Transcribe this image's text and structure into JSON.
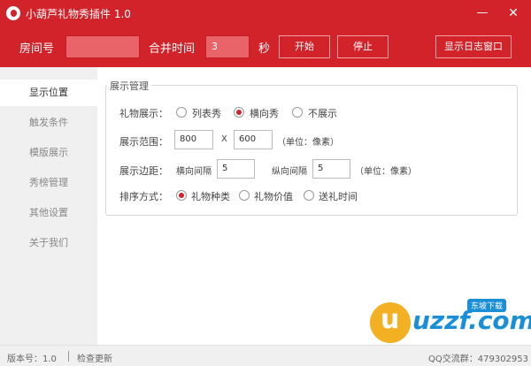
{
  "window": {
    "title": "小葫芦礼物秀插件 1.0",
    "minimize": "—",
    "close": "✕"
  },
  "toolbar": {
    "room_label": "房间号",
    "room_value": "",
    "merge_label": "合并时间",
    "merge_value": "3",
    "seconds_label": "秒",
    "start_label": "开始",
    "stop_label": "停止",
    "log_label": "显示日志窗口"
  },
  "sidebar": {
    "items": [
      {
        "label": "显示位置",
        "active": true
      },
      {
        "label": "触发条件",
        "active": false
      },
      {
        "label": "模版展示",
        "active": false
      },
      {
        "label": "秀榜管理",
        "active": false
      },
      {
        "label": "其他设置",
        "active": false
      },
      {
        "label": "关于我们",
        "active": false
      }
    ]
  },
  "display": {
    "group_title": "展示管理",
    "gift_show": {
      "label": "礼物展示：",
      "options": [
        "列表秀",
        "横向秀",
        "不展示"
      ],
      "selected": "横向秀"
    },
    "range": {
      "label": "展示范围：",
      "width": "800",
      "x": "X",
      "height": "600",
      "unit": "（单位：像素）"
    },
    "margin": {
      "label": "展示边距：",
      "h_label": "横向间隔",
      "h_value": "5",
      "v_label": "纵向间隔",
      "v_value": "5",
      "unit": "（单位：像素）"
    },
    "sort": {
      "label": "排序方式：",
      "options": [
        "礼物种类",
        "礼物价值",
        "送礼时间"
      ],
      "selected": "礼物种类"
    }
  },
  "status": {
    "version": "版本号：1.0",
    "update": "检查更新",
    "qq": "QQ交流群：479302953"
  },
  "watermark": {
    "text": "uzzf.com",
    "badge": "东坡下载"
  },
  "colors": {
    "accent": "#d2222a",
    "sidebar_bg": "#f0f0f0",
    "watermark_blue": "#1a8fd8",
    "watermark_orange": "#f2b022"
  }
}
